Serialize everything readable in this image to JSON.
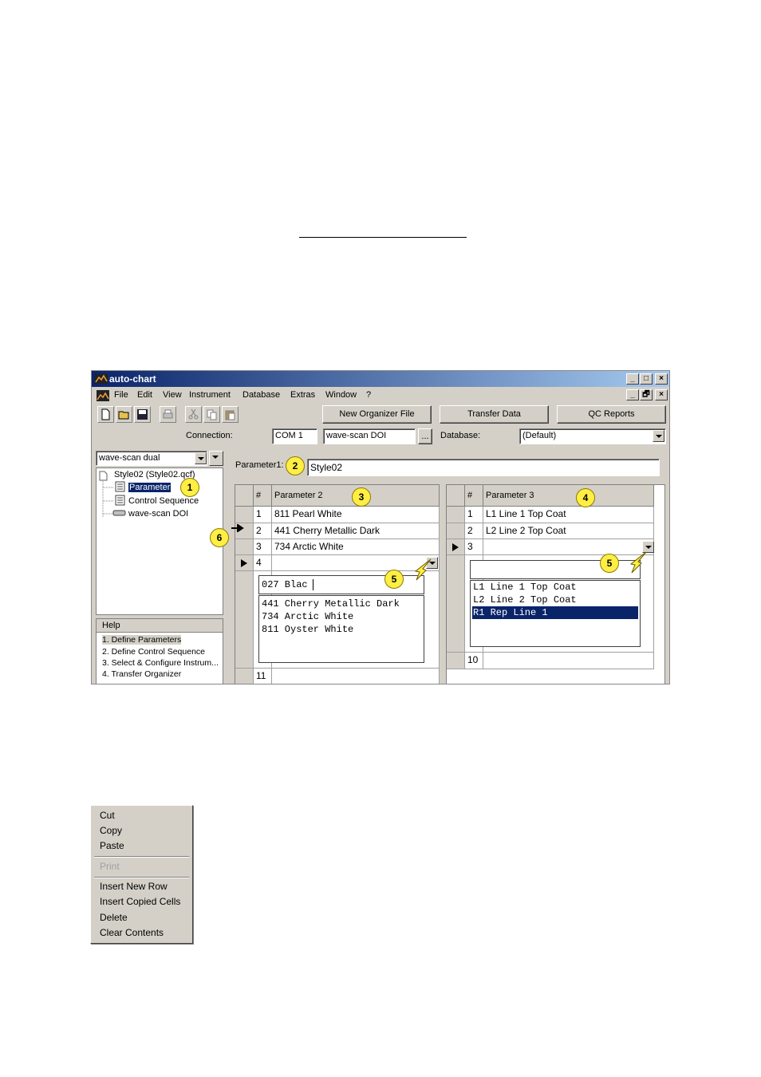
{
  "window": {
    "title": "auto-chart",
    "controls": {
      "minimize": "_",
      "maximize": "□",
      "close": "×",
      "restore": "🗗"
    }
  },
  "menu": [
    "File",
    "Edit",
    "View",
    "Instrument",
    "Database",
    "Extras",
    "Window",
    "?"
  ],
  "toolbar": {
    "new_organizer": "New Organizer File",
    "transfer_data": "Transfer Data",
    "qc_reports": "QC Reports"
  },
  "connection": {
    "label": "Connection:",
    "port": "COM 1",
    "device": "wave-scan DOI",
    "browse": "...",
    "database_label": "Database:",
    "database_value": "(Default)"
  },
  "left": {
    "instrument_select": "wave-scan dual",
    "tree": {
      "root": "Style02  (Style02.qcf)",
      "items": [
        "Parameter",
        "Control Sequence",
        "wave-scan DOI"
      ]
    },
    "help": {
      "title": "Help",
      "items": [
        "1. Define Parameters",
        "2. Define Control Sequence",
        "3. Select & Configure Instrum...",
        "4. Transfer Organizer"
      ]
    }
  },
  "parameter1": {
    "label": "Parameter1:",
    "value": "Style02"
  },
  "grid_left": {
    "col_num": "#",
    "header": "Parameter 2",
    "rows": [
      {
        "n": "1",
        "v": "811 Pearl White"
      },
      {
        "n": "2",
        "v": "441 Cherry Metallic Dark"
      },
      {
        "n": "3",
        "v": "734 Arctic White"
      },
      {
        "n": "4",
        "v": ""
      },
      {
        "n": "11",
        "v": ""
      }
    ],
    "popup_input": "027 Blac",
    "popup_items": [
      "441 Cherry Metallic Dark",
      "734 Arctic White",
      "811 Oyster White"
    ]
  },
  "grid_right": {
    "col_num": "#",
    "header": "Parameter 3",
    "rows": [
      {
        "n": "1",
        "v": "L1 Line 1 Top Coat"
      },
      {
        "n": "2",
        "v": "L2 Line 2 Top Coat"
      },
      {
        "n": "3",
        "v": ""
      },
      {
        "n": "10",
        "v": ""
      }
    ],
    "popup_items": [
      "L1 Line 1 Top Coat",
      "L2 Line 2 Top Coat",
      "R1 Rep Line 1"
    ]
  },
  "badges": [
    "1",
    "2",
    "3",
    "4",
    "5",
    "5",
    "6"
  ],
  "context_menu": {
    "items": [
      "Cut",
      "Copy",
      "Paste",
      "Print",
      "Insert New Row",
      "Insert Copied Cells",
      "Delete",
      "Clear Contents"
    ]
  },
  "colors": {
    "title_bar": "#0a246a",
    "face": "#d4d0c8",
    "selection": "#0a246a",
    "badge": "#ffee44"
  }
}
